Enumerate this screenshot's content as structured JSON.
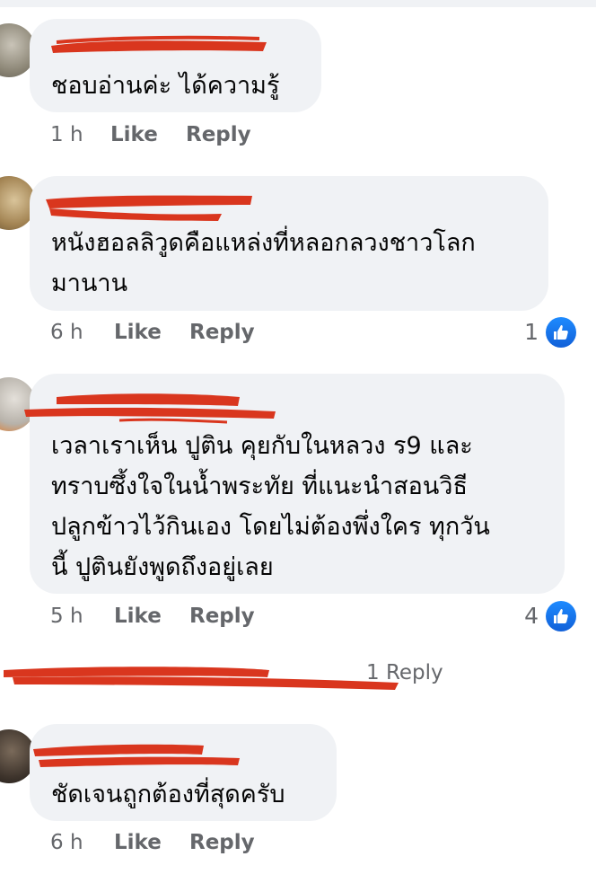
{
  "comments": [
    {
      "text_lines": [
        "ชอบอ่านค่ะ ได้ความรู้"
      ],
      "time": "1 h",
      "like": "Like",
      "reply": "Reply",
      "reactions": ""
    },
    {
      "text_lines": [
        "หนังฮอลลิวูดคือแหล่งที่หลอกลวงชาวโลก",
        "มานาน"
      ],
      "time": "6 h",
      "like": "Like",
      "reply": "Reply",
      "reactions": "1"
    },
    {
      "text_lines": [
        "เวลาเราเห็น ปูติน คุยกับในหลวง ร9 และ",
        "ทราบซึ้งใจในน้ำพระทัย ที่แนะนำสอนวิธี",
        "ปลูกข้าวไว้กินเอง โดยไม่ต้องพึ่งใคร ทุกวัน",
        "นี้ ปูตินยังพูดถึงอยู่เลย"
      ],
      "time": "5 h",
      "like": "Like",
      "reply": "Reply",
      "reactions": "4",
      "replies_text": "1 Reply"
    },
    {
      "text_lines": [
        "ชัดเจนถูกต้องที่สุดครับ"
      ],
      "time": "6 h",
      "like": "Like",
      "reply": "Reply",
      "reactions": ""
    }
  ],
  "colors": {
    "bubble": "#f0f2f5",
    "redaction": "#d9361e",
    "like_blue": "#1877f2",
    "meta": "#65676b"
  }
}
